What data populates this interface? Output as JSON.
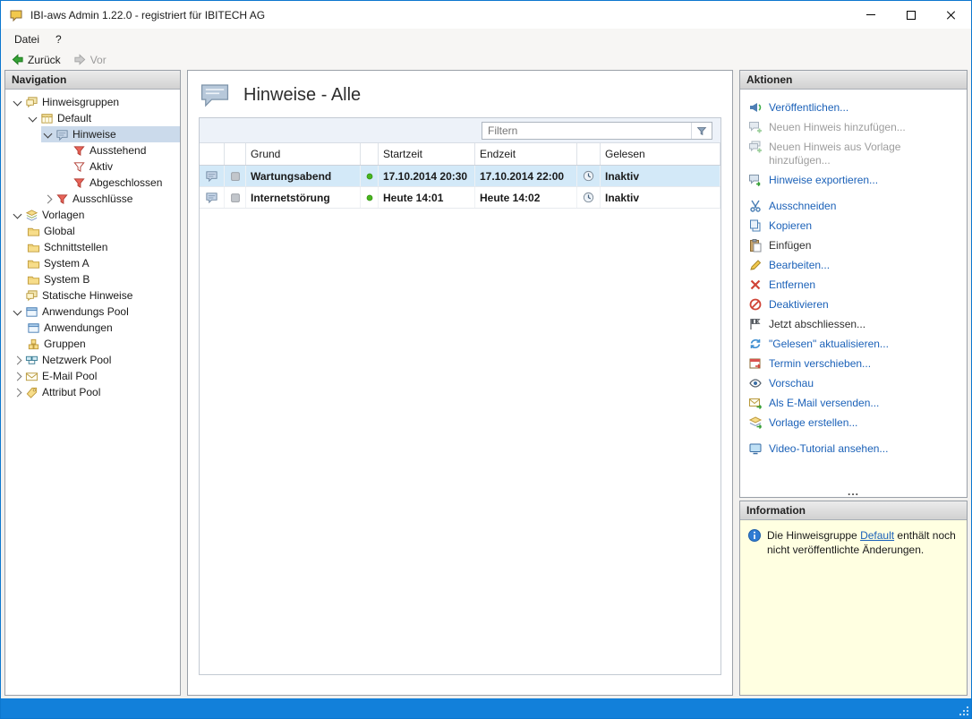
{
  "window": {
    "title": "IBI-aws Admin 1.22.0 - registriert für IBITECH AG",
    "app_icon": "app-icon",
    "controls": [
      "minimize-icon",
      "maximize-icon",
      "close-icon"
    ]
  },
  "menu": {
    "items": [
      {
        "label": "Datei"
      },
      {
        "label": "?"
      }
    ]
  },
  "toolbar": {
    "back_label": "Zurück",
    "forward_label": "Vor",
    "back_icon": "arrow-left-green-icon",
    "forward_icon": "arrow-right-gray-icon"
  },
  "navigation": {
    "header": "Navigation",
    "items": [
      {
        "label": "Hinweisgruppen",
        "level": 0,
        "state": "expanded",
        "icon": "hinweisgruppen-icon",
        "selected": false
      },
      {
        "label": "Default",
        "level": 1,
        "state": "expanded",
        "icon": "default-group-icon",
        "selected": false
      },
      {
        "label": "Hinweise",
        "level": 2,
        "state": "expanded",
        "icon": "hinweis-bubble-icon",
        "selected": true
      },
      {
        "label": "Ausstehend",
        "level": 3,
        "state": "leaf",
        "icon": "filter-red-icon",
        "selected": false
      },
      {
        "label": "Aktiv",
        "level": 3,
        "state": "leaf",
        "icon": "filter-light-icon",
        "selected": false
      },
      {
        "label": "Abgeschlossen",
        "level": 3,
        "state": "leaf",
        "icon": "filter-red-icon",
        "selected": false
      },
      {
        "label": "Ausschlüsse",
        "level": 2,
        "state": "collapsed",
        "icon": "filter-red-icon",
        "selected": false
      },
      {
        "label": "Vorlagen",
        "level": 0,
        "state": "expanded",
        "icon": "vorlagen-icon",
        "selected": false
      },
      {
        "label": "Global",
        "level": 1,
        "state": "leaf",
        "icon": "folder-icon",
        "selected": false
      },
      {
        "label": "Schnittstellen",
        "level": 1,
        "state": "leaf",
        "icon": "folder-icon",
        "selected": false
      },
      {
        "label": "System A",
        "level": 1,
        "state": "leaf",
        "icon": "folder-icon",
        "selected": false
      },
      {
        "label": "System B",
        "level": 1,
        "state": "leaf",
        "icon": "folder-icon",
        "selected": false
      },
      {
        "label": "Statische Hinweise",
        "level": 0,
        "state": "leaf",
        "icon": "hinweisgruppen-icon",
        "selected": false
      },
      {
        "label": "Anwendungs Pool",
        "level": 0,
        "state": "expanded",
        "icon": "app-window-icon",
        "selected": false
      },
      {
        "label": "Anwendungen",
        "level": 1,
        "state": "leaf",
        "icon": "app-window-icon",
        "selected": false
      },
      {
        "label": "Gruppen",
        "level": 1,
        "state": "leaf",
        "icon": "gruppen-icon",
        "selected": false
      },
      {
        "label": "Netzwerk Pool",
        "level": 0,
        "state": "collapsed",
        "icon": "network-icon",
        "selected": false
      },
      {
        "label": "E-Mail Pool",
        "level": 0,
        "state": "collapsed",
        "icon": "email-icon",
        "selected": false
      },
      {
        "label": "Attribut Pool",
        "level": 0,
        "state": "collapsed",
        "icon": "tag-icon",
        "selected": false
      }
    ]
  },
  "content": {
    "title": "Hinweise - Alle",
    "title_icon": "hinweis-bubble-large-icon",
    "filter_placeholder": "Filtern",
    "filter_icon": "filter-funnel-icon",
    "table": {
      "columns": {
        "grund": "Grund",
        "startzeit": "Startzeit",
        "endzeit": "Endzeit",
        "gelesen": "Gelesen"
      },
      "rows": [
        {
          "row_icons": [
            "hinweis-bubble-icon",
            "gray-square-icon"
          ],
          "grund": "Wartungsabend",
          "status_icon": "green-dot-icon",
          "startzeit": "17.10.2014 20:30",
          "endzeit": "17.10.2014 22:00",
          "gelesen_icon": "status-clock-icon",
          "gelesen": "Inaktiv",
          "selected": true
        },
        {
          "row_icons": [
            "hinweis-bubble-icon",
            "gray-square-icon"
          ],
          "grund": "Internetstörung",
          "status_icon": "green-dot-icon",
          "startzeit": "Heute 14:01",
          "endzeit": "Heute 14:02",
          "gelesen_icon": "status-clock-icon",
          "gelesen": "Inaktiv",
          "selected": false
        }
      ]
    }
  },
  "actions": {
    "header": "Aktionen",
    "more_indicator": "...",
    "items": [
      {
        "label": "Veröffentlichen...",
        "state": "enabled",
        "icon": "publish-icon"
      },
      {
        "label": "Neuen Hinweis hinzufügen...",
        "state": "disabled",
        "icon": "add-hinweis-icon"
      },
      {
        "label": "Neuen Hinweis aus Vorlage hinzufügen...",
        "state": "disabled",
        "icon": "add-from-template-icon"
      },
      {
        "label": "Hinweise exportieren...",
        "state": "enabled",
        "icon": "export-icon"
      },
      {
        "label": "Ausschneiden",
        "state": "enabled",
        "icon": "cut-icon"
      },
      {
        "label": "Kopieren",
        "state": "enabled",
        "icon": "copy-icon"
      },
      {
        "label": "Einfügen",
        "state": "plain",
        "icon": "paste-icon"
      },
      {
        "label": "Bearbeiten...",
        "state": "enabled",
        "icon": "edit-icon"
      },
      {
        "label": "Entfernen",
        "state": "enabled",
        "icon": "remove-icon"
      },
      {
        "label": "Deaktivieren",
        "state": "enabled",
        "icon": "deactivate-icon"
      },
      {
        "label": "Jetzt abschliessen...",
        "state": "plain",
        "icon": "finish-icon"
      },
      {
        "label": "\"Gelesen\" aktualisieren...",
        "state": "enabled",
        "icon": "refresh-icon"
      },
      {
        "label": "Termin verschieben...",
        "state": "enabled",
        "icon": "reschedule-icon"
      },
      {
        "label": "Vorschau",
        "state": "enabled",
        "icon": "preview-icon"
      },
      {
        "label": "Als E-Mail versenden...",
        "state": "enabled",
        "icon": "send-email-icon"
      },
      {
        "label": "Vorlage erstellen...",
        "state": "enabled",
        "icon": "create-template-icon"
      },
      {
        "label": "Video-Tutorial ansehen...",
        "state": "enabled",
        "icon": "video-tutorial-icon"
      }
    ]
  },
  "information": {
    "header": "Information",
    "icon": "info-icon",
    "text_before": "Die Hinweisgruppe ",
    "link": "Default",
    "text_after": " enthält noch nicht veröffentlichte Änderungen."
  },
  "colors": {
    "accent_border": "#0c77cf",
    "statusbar": "#1280da",
    "action_link": "#1b61b8",
    "disabled_text": "#9d9d9d",
    "tree_selection": "#cbdaeb",
    "row_selection": "#d3e9f8",
    "info_background": "#ffffe1"
  }
}
